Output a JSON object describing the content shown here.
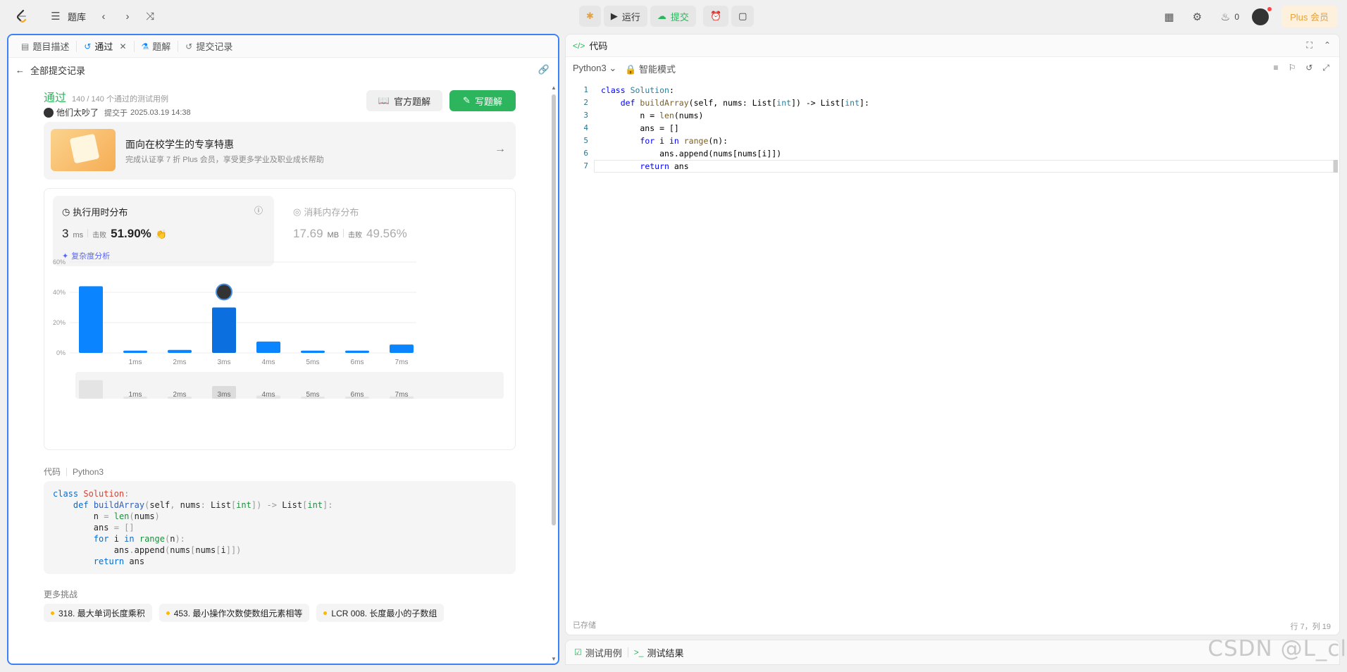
{
  "topbar": {
    "problem_bank": "题库",
    "run": "运行",
    "submit": "提交",
    "streak_count": "0",
    "plus": "Plus 会员"
  },
  "left": {
    "tabs": [
      {
        "label": "题目描述",
        "icon": "doc-icon"
      },
      {
        "label": "通过",
        "icon": "history-icon"
      },
      {
        "label": "题解",
        "icon": "flask-icon"
      },
      {
        "label": "提交记录",
        "icon": "history-icon"
      }
    ],
    "back_label": "全部提交记录",
    "status": "通过",
    "cases": "140 / 140 个通过的测试用例",
    "author": "他们太吵了",
    "submitted_prefix": "提交于",
    "submitted_time": "2025.03.19 14:38",
    "official_solution": "官方题解",
    "write_solution": "写题解",
    "promo_title": "面向在校学生的专享特惠",
    "promo_sub": "完成认证享 7 折 Plus 会员，享受更多学业及职业成长帮助",
    "runtime_title": "执行用时分布",
    "runtime_value": "3",
    "runtime_unit": "ms",
    "beats_label": "击败",
    "runtime_beats": "51.90%",
    "complexity_label": "复杂度分析",
    "memory_title": "消耗内存分布",
    "memory_value": "17.69",
    "memory_unit": "MB",
    "memory_beats": "49.56%",
    "code_label": "代码",
    "code_lang": "Python3",
    "more_title": "更多挑战",
    "challenges": [
      "318. 最大单词长度乘积",
      "453. 最小操作次数使数组元素相等",
      "LCR 008. 长度最小的子数组"
    ]
  },
  "chart_data": {
    "type": "bar",
    "categories": [
      "",
      "1ms",
      "2ms",
      "3ms",
      "4ms",
      "5ms",
      "6ms",
      "7ms"
    ],
    "values": [
      44,
      1.5,
      2,
      30,
      7.5,
      1.5,
      1.5,
      5.5
    ],
    "ytick_labels": [
      "0%",
      "20%",
      "40%",
      "60%"
    ],
    "ylim": [
      0,
      60
    ],
    "highlight_category": "3ms",
    "accent": "#0a84ff"
  },
  "right": {
    "header": "代码",
    "lang": "Python3",
    "smart_mode": "智能模式",
    "saved": "已存储",
    "cursor_pos": "行 7，列 19",
    "line_numbers": [
      "1",
      "2",
      "3",
      "4",
      "5",
      "6",
      "7"
    ]
  },
  "bottom": {
    "test_cases": "测试用例",
    "test_result": "测试结果"
  },
  "watermark": "CSDN @L_cl"
}
